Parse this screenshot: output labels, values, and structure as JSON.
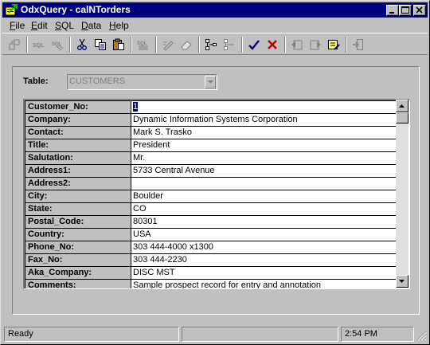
{
  "window": {
    "title": "OdxQuery - calNTorders"
  },
  "menu": [
    {
      "label": "File",
      "accel": "F",
      "rest": "ile"
    },
    {
      "label": "Edit",
      "accel": "E",
      "rest": "dit"
    },
    {
      "label": "SQL",
      "accel": "S",
      "rest": "QL"
    },
    {
      "label": "Data",
      "accel": "D",
      "rest": "ata"
    },
    {
      "label": "Help",
      "accel": "H",
      "rest": "elp"
    }
  ],
  "toolbar": {
    "icons": [
      "connect-icon",
      "sql-icon",
      "sql-run-icon",
      "cut-icon",
      "copy-icon",
      "paste-icon",
      "sql-query-icon",
      "pencil-icon",
      "eraser-icon",
      "tree-icon",
      "tree-collapse-icon",
      "check-icon",
      "cancel-icon",
      "record-first-icon",
      "record-next-icon",
      "record-edit-icon",
      "exit-icon"
    ],
    "colors": {
      "check": "#000080",
      "cancel": "#c00000",
      "disabled": "#808080"
    }
  },
  "table_selector": {
    "label": "Table:",
    "value": "CUSTOMERS"
  },
  "grid": {
    "rows": [
      {
        "field": "Customer_No:",
        "value": "1"
      },
      {
        "field": "Company:",
        "value": "Dynamic Information Systems Corporation"
      },
      {
        "field": "Contact:",
        "value": "Mark S. Trasko"
      },
      {
        "field": "Title:",
        "value": "President"
      },
      {
        "field": "Salutation:",
        "value": "Mr."
      },
      {
        "field": "Address1:",
        "value": "5733 Central Avenue"
      },
      {
        "field": "Address2:",
        "value": ""
      },
      {
        "field": "City:",
        "value": "Boulder"
      },
      {
        "field": "State:",
        "value": "CO"
      },
      {
        "field": "Postal_Code:",
        "value": "80301"
      },
      {
        "field": "Country:",
        "value": "USA"
      },
      {
        "field": "Phone_No:",
        "value": "303 444-4000 x1300"
      },
      {
        "field": "Fax_No:",
        "value": "303 444-2230"
      },
      {
        "field": "Aka_Company:",
        "value": "DISC   MST"
      },
      {
        "field": "Comments:",
        "value": "Sample prospect record for entry and annotation"
      }
    ]
  },
  "status": {
    "message": "Ready",
    "middle": "",
    "time": "2:54 PM"
  },
  "colors": {
    "titlebar": "#000080",
    "face": "#c0c0c0",
    "selection": "#000080"
  }
}
